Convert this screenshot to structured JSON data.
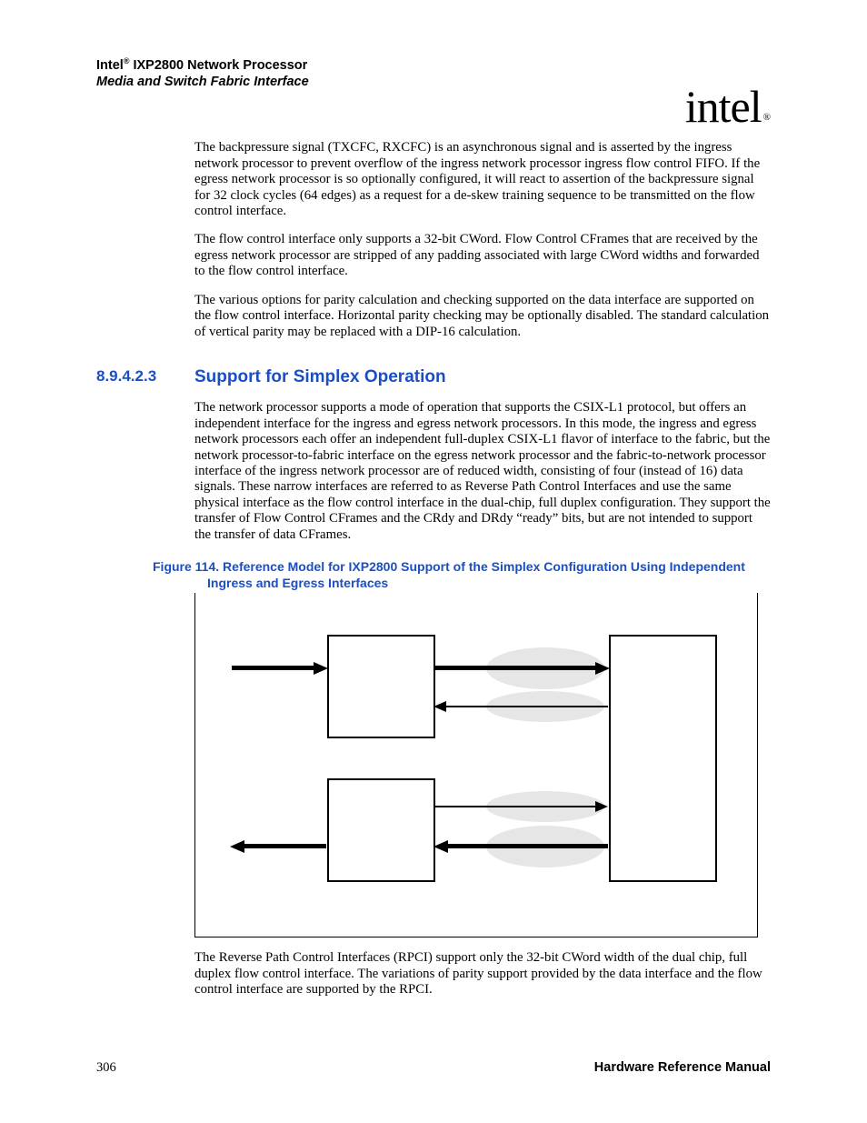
{
  "header": {
    "brand": "Intel",
    "reg": "®",
    "product": " IXP2800 Network Processor",
    "subtitle": "Media and Switch Fabric Interface"
  },
  "logo": {
    "text": "intel",
    "reg": "®"
  },
  "paragraphs": {
    "p1": "The backpressure signal (TXCFC, RXCFC) is an asynchronous signal and is asserted by the ingress network processor to prevent overflow of the ingress network processor ingress flow control FIFO. If the egress network processor is so optionally configured, it will react to assertion of the backpressure signal for 32 clock cycles (64 edges) as a request for a de-skew training sequence to be transmitted on the flow control interface.",
    "p2": "The flow control interface only supports a 32-bit CWord. Flow Control CFrames that are received by the egress network processor are stripped of any padding associated with large CWord widths and forwarded to the flow control interface.",
    "p3": "The various options for parity calculation and checking supported on the data interface are supported on the flow control interface. Horizontal parity checking may be optionally disabled. The standard calculation of vertical parity may be replaced with a DIP-16 calculation.",
    "p4": "The network processor supports a mode of operation that supports the CSIX-L1 protocol, but offers an independent interface for the ingress and egress network processors. In this mode, the ingress and egress network processors each offer an independent full-duplex CSIX-L1 flavor of interface to the fabric, but the network processor-to-fabric interface on the egress network processor and the fabric-to-network processor interface of the ingress network processor are of reduced width, consisting of four (instead of 16) data signals. These narrow interfaces are referred to as Reverse Path Control Interfaces and use the same physical interface as the flow control interface in the dual-chip, full duplex configuration. They support the transfer of Flow Control CFrames and the CRdy and DRdy “ready” bits, but are not intended to support the transfer of data CFrames.",
    "p5": "The Reverse Path Control Interfaces (RPCI) support only the 32-bit CWord width of the dual chip, full duplex flow control interface. The variations of parity support provided by the data interface and the flow control interface are supported by the RPCI."
  },
  "section": {
    "number": "8.9.4.2.3",
    "title": "Support for Simplex Operation"
  },
  "figure": {
    "label": "Figure 114. ",
    "caption": "Reference Model for IXP2800 Support of the Simplex Configuration Using Independent Ingress and Egress Interfaces"
  },
  "footer": {
    "page": "306",
    "doc": "Hardware Reference Manual"
  }
}
